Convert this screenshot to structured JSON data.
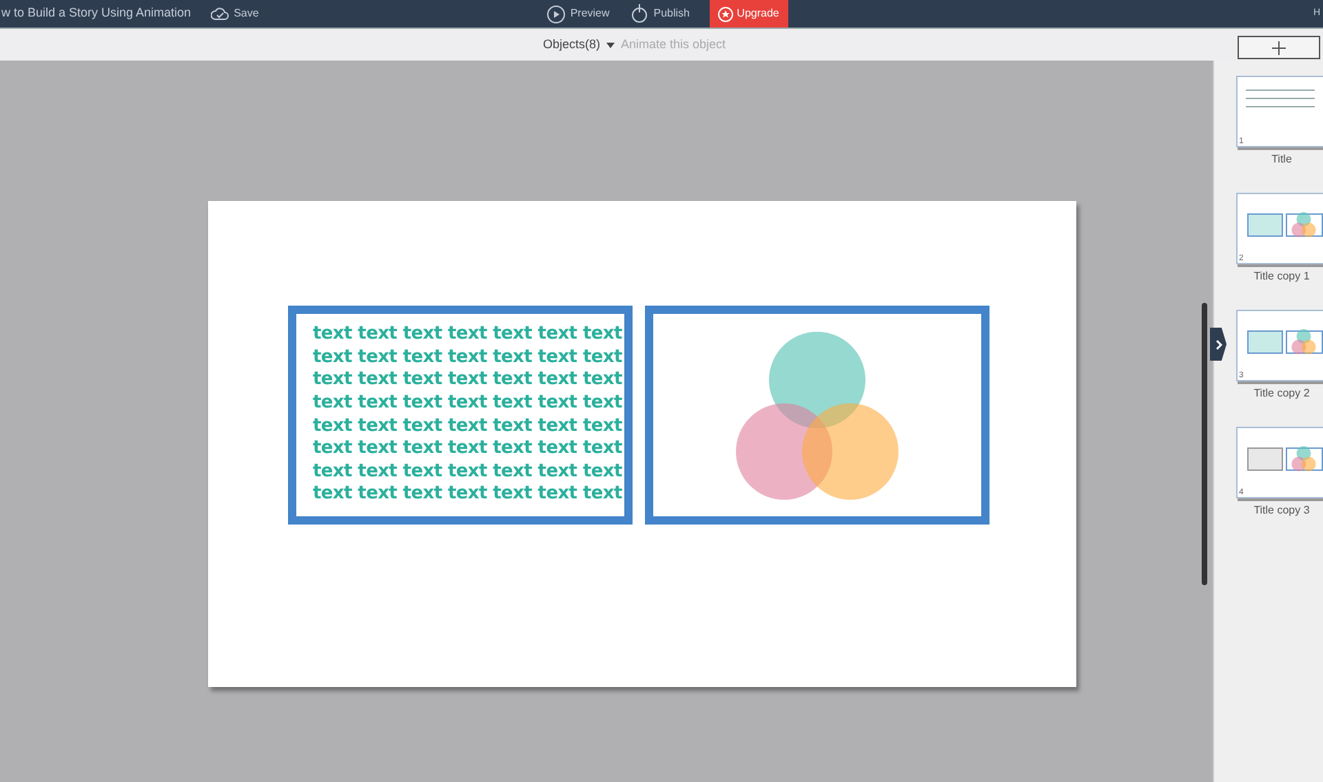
{
  "top_bar": {
    "title": "w to Build a Story Using Animation",
    "save": "Save",
    "preview": "Preview",
    "publish": "Publish",
    "upgrade": "Upgrade",
    "right_cut": "H"
  },
  "toolbar": {
    "objects": "Objects(8)",
    "animate": "Animate this object"
  },
  "slide": {
    "text_lines": [
      "text text text text text text text",
      "text text text text text text text",
      "text text text text text text text",
      "text text text text text text text",
      "text text text text text text text",
      "text text text text text text text",
      "text text text text text text text",
      "text text text text text text text"
    ]
  },
  "slides_panel": [
    {
      "number": "1",
      "label": "Title",
      "kind": "bullets"
    },
    {
      "number": "2",
      "label": "Title copy 1",
      "kind": "grid"
    },
    {
      "number": "3",
      "label": "Title copy 2",
      "kind": "grid"
    },
    {
      "number": "4",
      "label": "Title copy 3",
      "kind": "plain"
    }
  ]
}
